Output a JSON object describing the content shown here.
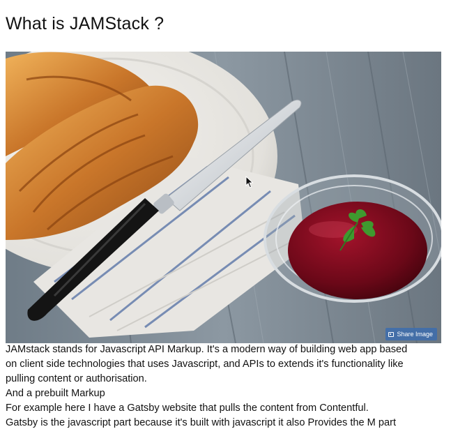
{
  "article": {
    "title": "What is JAMStack ?",
    "share_button_label": "Share Image",
    "paragraphs": [
      "JAMstack stands for Javascript API Markup. It's a modern way of building web app based",
      "on client side technologies that uses Javascript, and APIs to extends it's functionality like",
      "pulling content or authorisation.",
      "And a prebuilt Markup",
      "For example here I have a Gatsby website that pulls the content from Contentful.",
      "Gatsby is the javascript part because it's built with javascript it also Provides the M part"
    ]
  },
  "icons": {
    "share": "share-image-icon",
    "cursor": "mouse-cursor-icon"
  },
  "colors": {
    "share_button_bg": "#406eaa",
    "text": "#111111"
  }
}
